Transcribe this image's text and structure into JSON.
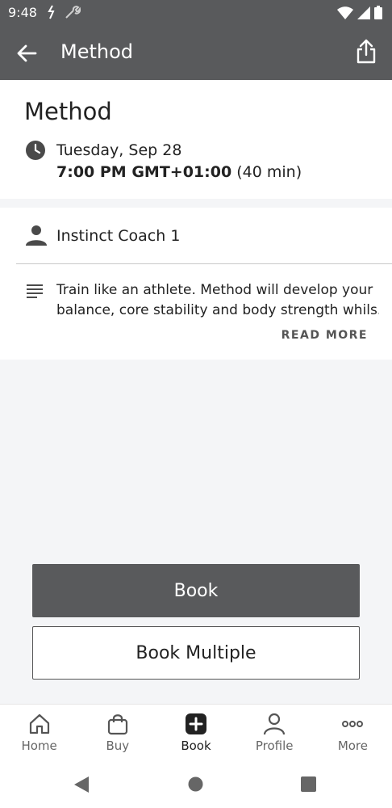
{
  "status_bar": {
    "time": "9:48"
  },
  "app_bar": {
    "title": "Method"
  },
  "class_info": {
    "name": "Method",
    "date": "Tuesday, Sep 28",
    "time": "7:00 PM GMT+01:00",
    "duration": "(40 min)"
  },
  "coach": {
    "name": "Instinct Coach 1"
  },
  "description": {
    "line1": "Train like an athlete. Method will develop your",
    "line2": "balance, core stability and body strength whils...",
    "read_more": "READ MORE"
  },
  "actions": {
    "book": "Book",
    "book_multiple": "Book Multiple"
  },
  "tabs": [
    {
      "label": "Home",
      "icon": "home-icon"
    },
    {
      "label": "Buy",
      "icon": "shopping-bag-icon"
    },
    {
      "label": "Book",
      "icon": "plus-square-icon",
      "active": true
    },
    {
      "label": "Profile",
      "icon": "person-icon"
    },
    {
      "label": "More",
      "icon": "more-dots-icon"
    }
  ],
  "colors": {
    "header": "#595a5c",
    "primary_button": "#595a5c",
    "background": "#f4f5f7"
  }
}
